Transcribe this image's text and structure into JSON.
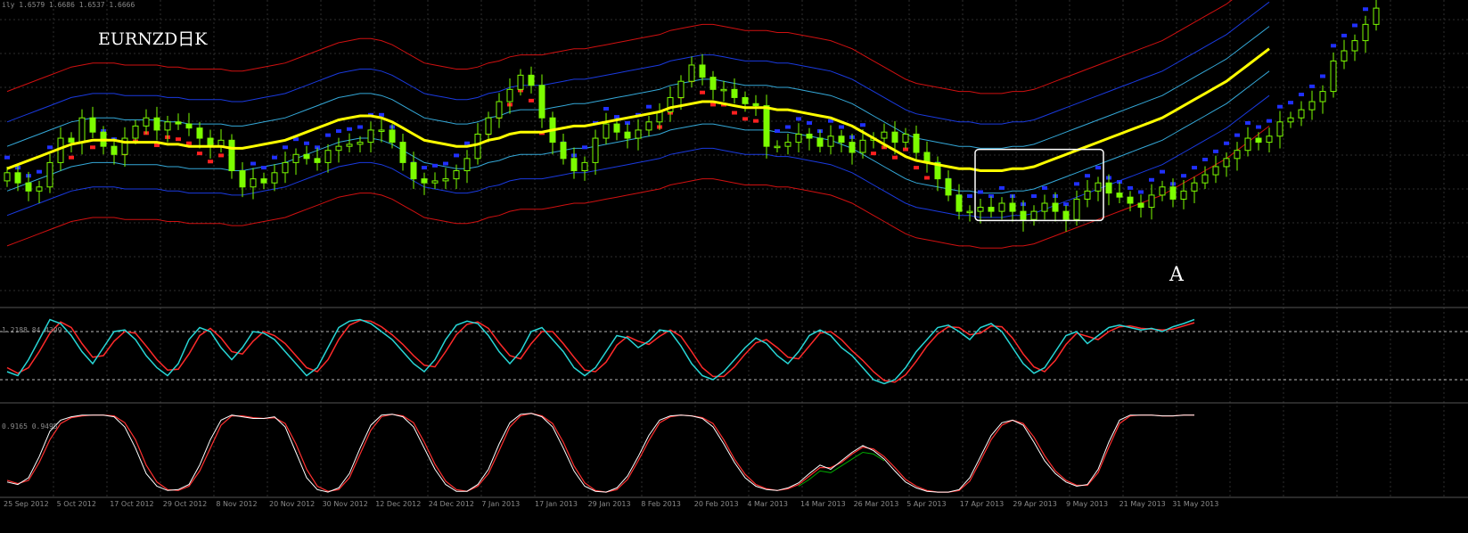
{
  "chart_data": {
    "type": "candlestick",
    "symbol_label": "EURNZD日K",
    "annotation_label": "A",
    "colors": {
      "background": "#000000",
      "grid": "#2e2e2e",
      "candle": "#7CFC00",
      "ma": "#ffff00",
      "band_outer": "#d01010",
      "band_mid": "#1a3adf",
      "band_inner": "#34a8d8",
      "sar_up": "#ff2020",
      "sar_down": "#2030ff",
      "stoch_main": "#28d6d6",
      "stoch_signal": "#ff2a2a",
      "osc2_main": "#ffffff",
      "osc2_signal": "#ff3030",
      "osc2_extra": "#00aa00"
    },
    "panels": {
      "price": {
        "header": "ily  1.6579 1.6686 1.6537 1.6666",
        "ylim": [
          1.52,
          1.67
        ],
        "close": [
          1.585,
          1.58,
          1.576,
          1.578,
          1.59,
          1.602,
          1.6,
          1.612,
          1.605,
          1.598,
          1.594,
          1.602,
          1.608,
          1.612,
          1.606,
          1.61,
          1.609,
          1.607,
          1.602,
          1.598,
          1.601,
          1.586,
          1.578,
          1.582,
          1.58,
          1.585,
          1.59,
          1.594,
          1.592,
          1.59,
          1.596,
          1.598,
          1.599,
          1.6,
          1.606,
          1.606,
          1.6,
          1.59,
          1.582,
          1.58,
          1.581,
          1.582,
          1.586,
          1.592,
          1.604,
          1.612,
          1.62,
          1.626,
          1.633,
          1.628,
          1.612,
          1.6,
          1.592,
          1.586,
          1.59,
          1.602,
          1.609,
          1.605,
          1.602,
          1.606,
          1.61,
          1.615,
          1.622,
          1.63,
          1.638,
          1.632,
          1.626,
          1.626,
          1.622,
          1.619,
          1.618,
          1.598,
          1.598,
          1.6,
          1.604,
          1.602,
          1.598,
          1.603,
          1.6,
          1.595,
          1.601,
          1.602,
          1.605,
          1.6,
          1.604,
          1.595,
          1.59,
          1.582,
          1.574,
          1.566,
          1.566,
          1.568,
          1.566,
          1.57,
          1.566,
          1.562,
          1.566,
          1.57,
          1.566,
          1.562,
          1.572,
          1.576,
          1.58,
          1.575,
          1.573,
          1.57,
          1.568,
          1.574,
          1.578,
          1.572,
          1.576,
          1.58,
          1.584,
          1.588,
          1.592,
          1.596,
          1.602,
          1.6,
          1.603,
          1.61,
          1.612,
          1.616,
          1.62,
          1.625,
          1.64,
          1.645,
          1.65,
          1.658,
          1.666
        ],
        "ma": [
          1.587,
          1.589,
          1.591,
          1.593,
          1.595,
          1.597,
          1.599,
          1.6,
          1.601,
          1.601,
          1.601,
          1.6,
          1.6,
          1.6,
          1.6,
          1.599,
          1.599,
          1.598,
          1.598,
          1.598,
          1.598,
          1.597,
          1.597,
          1.598,
          1.599,
          1.6,
          1.601,
          1.603,
          1.605,
          1.607,
          1.609,
          1.611,
          1.612,
          1.613,
          1.613,
          1.612,
          1.61,
          1.607,
          1.604,
          1.601,
          1.6,
          1.599,
          1.598,
          1.598,
          1.599,
          1.601,
          1.602,
          1.604,
          1.605,
          1.605,
          1.605,
          1.606,
          1.607,
          1.608,
          1.608,
          1.609,
          1.61,
          1.611,
          1.612,
          1.613,
          1.614,
          1.615,
          1.617,
          1.618,
          1.619,
          1.62,
          1.62,
          1.619,
          1.618,
          1.617,
          1.617,
          1.617,
          1.616,
          1.616,
          1.615,
          1.614,
          1.613,
          1.612,
          1.61,
          1.608,
          1.605,
          1.602,
          1.599,
          1.596,
          1.593,
          1.591,
          1.59,
          1.589,
          1.588,
          1.587,
          1.587,
          1.586,
          1.586,
          1.586,
          1.587,
          1.587,
          1.588,
          1.59,
          1.592,
          1.594,
          1.596,
          1.598,
          1.6,
          1.602,
          1.604,
          1.606,
          1.608,
          1.61,
          1.612,
          1.615,
          1.618,
          1.621,
          1.624,
          1.627,
          1.63,
          1.634,
          1.638,
          1.642,
          1.646
        ],
        "band_offsets": {
          "inner": 0.011,
          "mid": 0.023,
          "outer": 0.038
        },
        "box": {
          "from_bar": 91,
          "to_bar": 102,
          "low": 1.5615,
          "high": 1.5965
        },
        "x_ticks": [
          "25 Sep 2012",
          "5 Oct 2012",
          "17 Oct 2012",
          "29 Oct 2012",
          "8 Nov 2012",
          "20 Nov 2012",
          "30 Nov 2012",
          "12 Dec 2012",
          "24 Dec 2012",
          "7 Jan 2013",
          "17 Jan 2013",
          "29 Jan 2013",
          "8 Feb 2013",
          "20 Feb 2013",
          "4 Mar 2013",
          "14 Mar 2013",
          "26 Mar 2013",
          "5 Apr 2013",
          "17 Apr 2013",
          "29 Apr 2013",
          "9 May 2013",
          "21 May 2013",
          "31 May 2013"
        ]
      },
      "stochastic": {
        "header": "1.2188 84.4399",
        "levels": [
          80,
          20
        ],
        "main": [
          30,
          25,
          45,
          70,
          95,
          90,
          75,
          55,
          40,
          60,
          80,
          82,
          70,
          50,
          35,
          25,
          40,
          70,
          85,
          80,
          60,
          45,
          60,
          80,
          78,
          70,
          55,
          40,
          25,
          35,
          60,
          85,
          93,
          95,
          90,
          80,
          70,
          55,
          40,
          30,
          45,
          70,
          88,
          93,
          90,
          75,
          55,
          40,
          55,
          80,
          85,
          70,
          55,
          35,
          25,
          35,
          55,
          75,
          72,
          60,
          68,
          82,
          80,
          62,
          40,
          25,
          20,
          30,
          45,
          60,
          72,
          65,
          50,
          40,
          55,
          75,
          82,
          75,
          60,
          50,
          35,
          20,
          15,
          20,
          35,
          55,
          70,
          85,
          88,
          80,
          70,
          85,
          90,
          80,
          60,
          40,
          28,
          35,
          55,
          75,
          80,
          65,
          75,
          85,
          88,
          85,
          82,
          84,
          80,
          86,
          90,
          95
        ],
        "signal": [
          35,
          28,
          35,
          55,
          78,
          92,
          85,
          65,
          48,
          50,
          68,
          80,
          78,
          62,
          45,
          32,
          33,
          52,
          75,
          84,
          72,
          55,
          52,
          68,
          80,
          75,
          65,
          50,
          35,
          30,
          45,
          70,
          88,
          94,
          93,
          86,
          76,
          64,
          50,
          38,
          36,
          55,
          76,
          89,
          92,
          84,
          66,
          50,
          46,
          65,
          80,
          80,
          65,
          48,
          32,
          30,
          42,
          63,
          74,
          68,
          64,
          74,
          82,
          74,
          55,
          35,
          24,
          24,
          36,
          52,
          66,
          70,
          60,
          48,
          46,
          62,
          78,
          80,
          70,
          56,
          44,
          30,
          19,
          17,
          26,
          43,
          62,
          77,
          86,
          85,
          76,
          78,
          87,
          86,
          72,
          52,
          36,
          30,
          44,
          64,
          78,
          74,
          70,
          80,
          86,
          87,
          84,
          83,
          82,
          83,
          87,
          91
        ]
      },
      "oscillator": {
        "header": "0.9165 0.9495",
        "main": [
          15,
          12,
          20,
          45,
          75,
          88,
          92,
          94,
          94,
          94,
          92,
          80,
          55,
          25,
          10,
          5,
          6,
          12,
          35,
          65,
          88,
          94,
          92,
          90,
          90,
          92,
          80,
          50,
          20,
          6,
          3,
          8,
          25,
          55,
          82,
          94,
          95,
          92,
          80,
          55,
          30,
          12,
          4,
          4,
          12,
          30,
          60,
          85,
          95,
          96,
          92,
          80,
          55,
          28,
          10,
          4,
          3,
          8,
          22,
          45,
          70,
          88,
          93,
          94,
          93,
          90,
          80,
          60,
          38,
          20,
          10,
          6,
          5,
          8,
          14,
          25,
          35,
          30,
          40,
          50,
          58,
          52,
          42,
          28,
          15,
          8,
          4,
          3,
          3,
          6,
          20,
          45,
          70,
          85,
          88,
          82,
          62,
          40,
          25,
          15,
          10,
          12,
          30,
          62,
          88,
          94,
          94,
          94,
          93,
          93,
          94,
          94
        ],
        "signal": [
          17,
          13,
          17,
          38,
          65,
          84,
          91,
          93,
          94,
          94,
          93,
          85,
          65,
          35,
          15,
          6,
          5,
          10,
          28,
          55,
          82,
          93,
          93,
          91,
          90,
          91,
          84,
          60,
          30,
          10,
          4,
          6,
          20,
          48,
          76,
          92,
          95,
          93,
          85,
          62,
          36,
          16,
          6,
          4,
          10,
          25,
          52,
          80,
          93,
          96,
          93,
          84,
          62,
          34,
          14,
          5,
          3,
          6,
          18,
          40,
          64,
          85,
          92,
          94,
          93,
          91,
          84,
          65,
          42,
          24,
          12,
          7,
          5,
          7,
          12,
          22,
          32,
          32,
          38,
          48,
          56,
          54,
          45,
          32,
          18,
          10,
          5,
          3,
          3,
          5,
          16,
          40,
          65,
          82,
          88,
          84,
          68,
          46,
          28,
          17,
          11,
          11,
          26,
          56,
          84,
          93,
          94,
          94,
          93,
          93,
          94,
          94
        ],
        "extra_segment": {
          "from_bar": 74,
          "values": [
            10,
            18,
            28,
            26,
            34,
            42,
            50,
            48,
            40
          ]
        }
      }
    }
  }
}
